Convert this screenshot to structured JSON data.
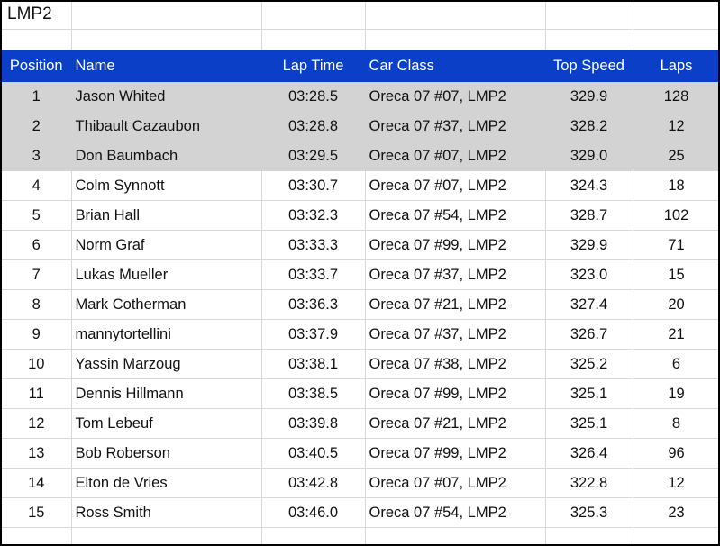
{
  "sheet": {
    "title": "LMP2"
  },
  "columns": [
    "Position",
    "Name",
    "Lap Time",
    "Car Class",
    "Top Speed",
    "Laps"
  ],
  "colors": {
    "header_bg": "#0b3fc7",
    "podium_bg": "#d3d3d3"
  },
  "rows": [
    {
      "position": "1",
      "name": "Jason Whited",
      "lap_time": "03:28.5",
      "car_class": "Oreca 07 #07, LMP2",
      "top_speed": "329.9",
      "laps": "128"
    },
    {
      "position": "2",
      "name": "Thibault Cazaubon",
      "lap_time": "03:28.8",
      "car_class": "Oreca 07 #37, LMP2",
      "top_speed": "328.2",
      "laps": "12"
    },
    {
      "position": "3",
      "name": "Don Baumbach",
      "lap_time": "03:29.5",
      "car_class": "Oreca 07 #07, LMP2",
      "top_speed": "329.0",
      "laps": "25"
    },
    {
      "position": "4",
      "name": "Colm Synnott",
      "lap_time": "03:30.7",
      "car_class": "Oreca 07 #07, LMP2",
      "top_speed": "324.3",
      "laps": "18"
    },
    {
      "position": "5",
      "name": "Brian Hall",
      "lap_time": "03:32.3",
      "car_class": "Oreca 07 #54, LMP2",
      "top_speed": "328.7",
      "laps": "102"
    },
    {
      "position": "6",
      "name": "Norm Graf",
      "lap_time": "03:33.3",
      "car_class": "Oreca 07 #99, LMP2",
      "top_speed": "329.9",
      "laps": "71"
    },
    {
      "position": "7",
      "name": "Lukas Mueller",
      "lap_time": "03:33.7",
      "car_class": "Oreca 07 #37, LMP2",
      "top_speed": "323.0",
      "laps": "15"
    },
    {
      "position": "8",
      "name": "Mark Cotherman",
      "lap_time": "03:36.3",
      "car_class": "Oreca 07 #21, LMP2",
      "top_speed": "327.4",
      "laps": "20"
    },
    {
      "position": "9",
      "name": "mannytortellini",
      "lap_time": "03:37.9",
      "car_class": "Oreca 07 #37, LMP2",
      "top_speed": "326.7",
      "laps": "21"
    },
    {
      "position": "10",
      "name": "Yassin Marzoug",
      "lap_time": "03:38.1",
      "car_class": "Oreca 07 #38, LMP2",
      "top_speed": "325.2",
      "laps": "6"
    },
    {
      "position": "11",
      "name": "Dennis Hillmann",
      "lap_time": "03:38.5",
      "car_class": "Oreca 07 #99, LMP2",
      "top_speed": "325.1",
      "laps": "19"
    },
    {
      "position": "12",
      "name": "Tom Lebeuf",
      "lap_time": "03:39.8",
      "car_class": "Oreca 07 #21, LMP2",
      "top_speed": "325.1",
      "laps": "8"
    },
    {
      "position": "13",
      "name": "Bob Roberson",
      "lap_time": "03:40.5",
      "car_class": "Oreca 07 #99, LMP2",
      "top_speed": "326.4",
      "laps": "96"
    },
    {
      "position": "14",
      "name": "Elton de Vries",
      "lap_time": "03:42.8",
      "car_class": "Oreca 07 #07, LMP2",
      "top_speed": "322.8",
      "laps": "12"
    },
    {
      "position": "15",
      "name": "Ross Smith",
      "lap_time": "03:46.0",
      "car_class": "Oreca 07 #54, LMP2",
      "top_speed": "325.3",
      "laps": "23"
    }
  ]
}
